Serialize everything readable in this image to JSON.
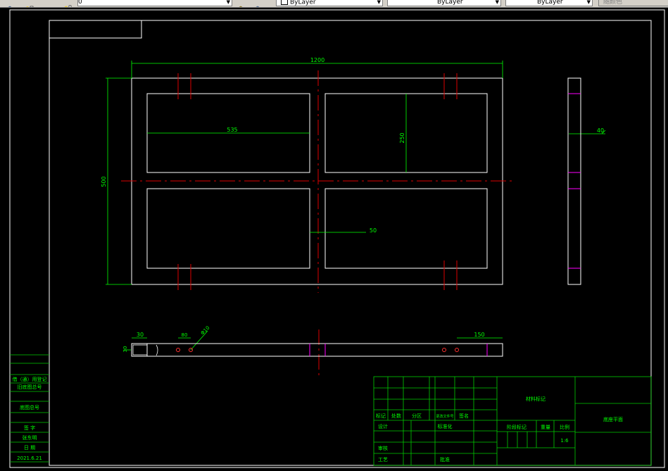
{
  "toolbar": {
    "layer_name": "0",
    "color_value": "ByLayer",
    "linetype_value": "ByLayer",
    "lineweight_value": "ByLayer",
    "plotstyle_value": "随颜色"
  },
  "colors": {
    "background": "#000000",
    "drawing_lines": "#ffffff",
    "dimension": "#00ff00",
    "centerline": "#ff0000",
    "marker": "#ff00ff"
  },
  "drawing": {
    "dim_width": "1200",
    "dim_height": "500",
    "dim_opening_width": "535",
    "dim_opening_height": "250",
    "dim_gap": "50",
    "dim_side_thickness": "40",
    "dim_edge": "30",
    "dim_hole_spacing": "150",
    "dim_hole_offset": "80",
    "dim_hole_dia": "Φ10",
    "dim_bottom_small": "30"
  },
  "left_panel": {
    "reg_label": "借（通）用登记",
    "old_label": "旧底图总号",
    "base_label": "底图总号",
    "sign_label": "签 字",
    "signer": "张东明",
    "date_label": "日 期",
    "date_value": "2021.6.21"
  },
  "title_block": {
    "material_label": "材料标记",
    "drawing_title": "底座平面",
    "mark_label": "标记",
    "count_label": "处数",
    "zone_label": "分区",
    "docno_label": "更改文件号",
    "sign_label": "签名",
    "design_label": "设计",
    "standard_label": "标准化",
    "stage_label": "阶段标记",
    "weight_label": "重量",
    "scale_label": "比例",
    "scale_value": "1:6",
    "review_label": "审核",
    "process_label": "工艺",
    "approve_label": "批准"
  }
}
